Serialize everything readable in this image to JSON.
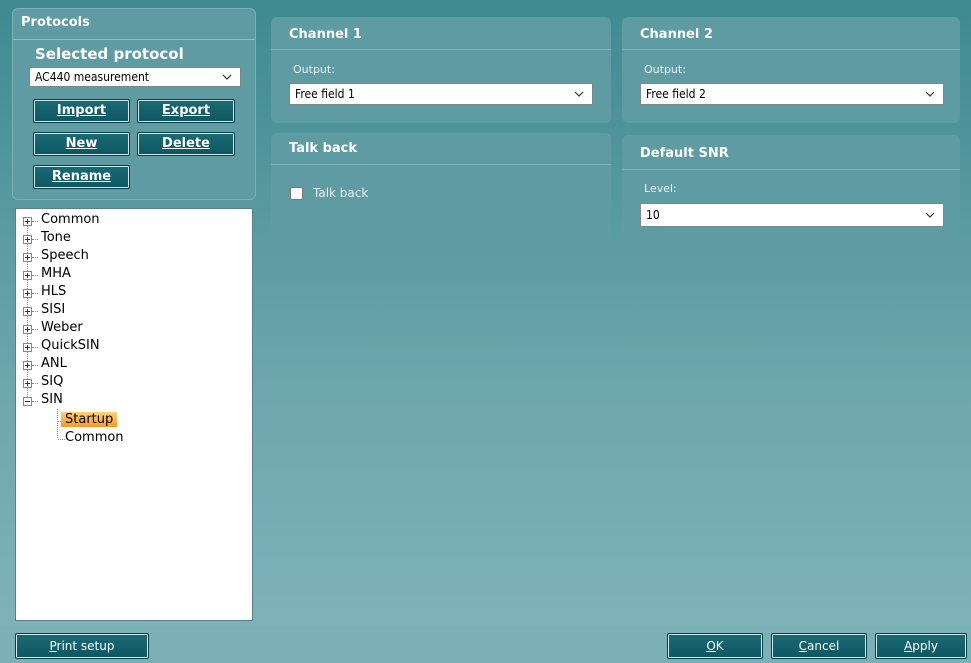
{
  "protocols": {
    "title": "Protocols",
    "selected_label": "Selected protocol",
    "selected_value": "AC440 measurement",
    "buttons": {
      "import": "Import",
      "export": "Export",
      "new": "New",
      "delete": "Delete",
      "rename": "Rename"
    }
  },
  "tree": {
    "items": [
      "Common",
      "Tone",
      "Speech",
      "MHA",
      "HLS",
      "SISI",
      "Weber",
      "QuickSIN",
      "ANL",
      "SIQ",
      "SIN"
    ],
    "children": [
      "Startup",
      "Common"
    ],
    "selected": "Startup"
  },
  "channel1": {
    "title": "Channel 1",
    "output_label": "Output:",
    "output_value": "Free field 1"
  },
  "channel2": {
    "title": "Channel 2",
    "output_label": "Output:",
    "output_value": "Free field 2"
  },
  "talkback": {
    "title": "Talk back",
    "checkbox_label": "Talk back",
    "checked": false
  },
  "default_snr": {
    "title": "Default SNR",
    "level_label": "Level:",
    "level_value": "10"
  },
  "footer": {
    "print_setup": "Print setup",
    "ok": "OK",
    "cancel": "Cancel",
    "apply": "Apply"
  }
}
